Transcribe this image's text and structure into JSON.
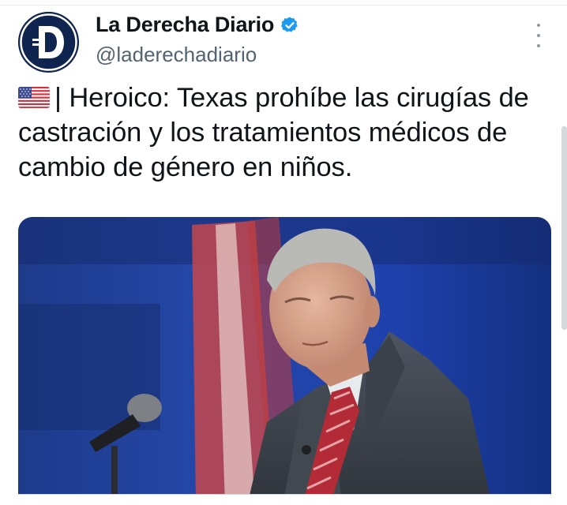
{
  "account": {
    "display_name": "La Derecha Diario",
    "handle": "@laderechadiario",
    "verified": true,
    "avatar_letter": "D",
    "avatar_color": "#0f2550",
    "verified_color": "#1d9bf0"
  },
  "tweet": {
    "flag_icon": "us-flag-icon",
    "separator": "| ",
    "text": "Heroico: Texas prohíbe las cirugías de castración y los tratamientos médicos de cambio de género en niños."
  },
  "media": {
    "icon": "photo-man-at-microphone"
  },
  "menu": {
    "icon": "more-options-icon"
  }
}
